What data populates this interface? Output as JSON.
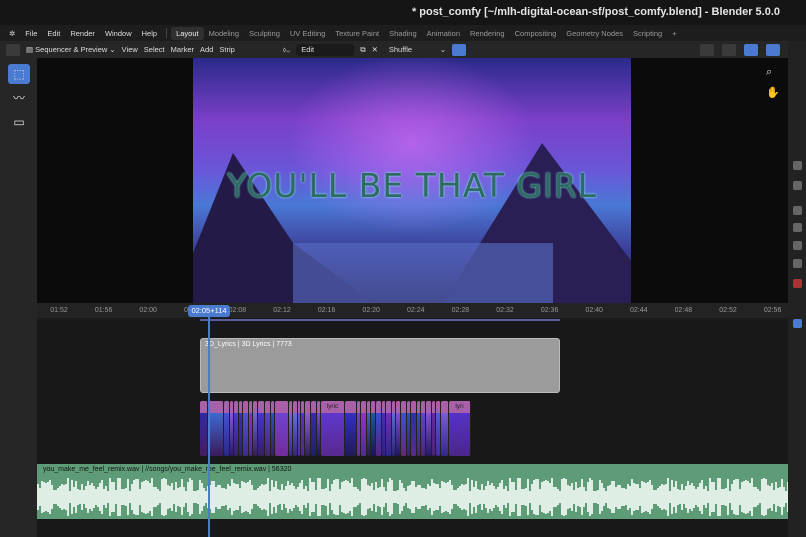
{
  "window": {
    "title": "* post_comfy [~/mlh-digital-ocean-sf/post_comfy.blend] - Blender 5.0.0"
  },
  "menu": [
    "File",
    "Edit",
    "Render",
    "Window",
    "Help"
  ],
  "workspaces": [
    {
      "label": "Layout",
      "active": true
    },
    {
      "label": "Modeling"
    },
    {
      "label": "Sculpting"
    },
    {
      "label": "UV Editing"
    },
    {
      "label": "Texture Paint"
    },
    {
      "label": "Shading"
    },
    {
      "label": "Animation"
    },
    {
      "label": "Rendering"
    },
    {
      "label": "Compositing"
    },
    {
      "label": "Geometry Nodes"
    },
    {
      "label": "Scripting"
    }
  ],
  "header": {
    "editor_mode": "Sequencer & Preview",
    "menus": [
      "View",
      "Select",
      "Marker",
      "Add",
      "Strip"
    ],
    "edit_field": "Edit",
    "blend_mode": "Shuffle"
  },
  "preview": {
    "overlay_text": "YOU'LL BE THAT GIRL"
  },
  "timeline": {
    "ticks": [
      "01:52",
      "01:56",
      "02:00",
      "02:04",
      "02:08",
      "02:12",
      "02:16",
      "02:20",
      "02:24",
      "02:28",
      "02:32",
      "02:36",
      "02:40",
      "02:44",
      "02:48",
      "02:52",
      "02:56"
    ],
    "current_time": "02:05+114",
    "text_strip": "3D_Lyrics | 3D Lyrics | 7773",
    "clip_labels": [
      "lyric",
      "lyri"
    ],
    "audio_strip": "you_make_me_feel_remix.wav | //songs/you_make_me_feel_remix.wav | 56320"
  },
  "colors": {
    "accent": "#4a7bd1",
    "audio": "#5e9c77",
    "clip_header": "#a860a8"
  }
}
